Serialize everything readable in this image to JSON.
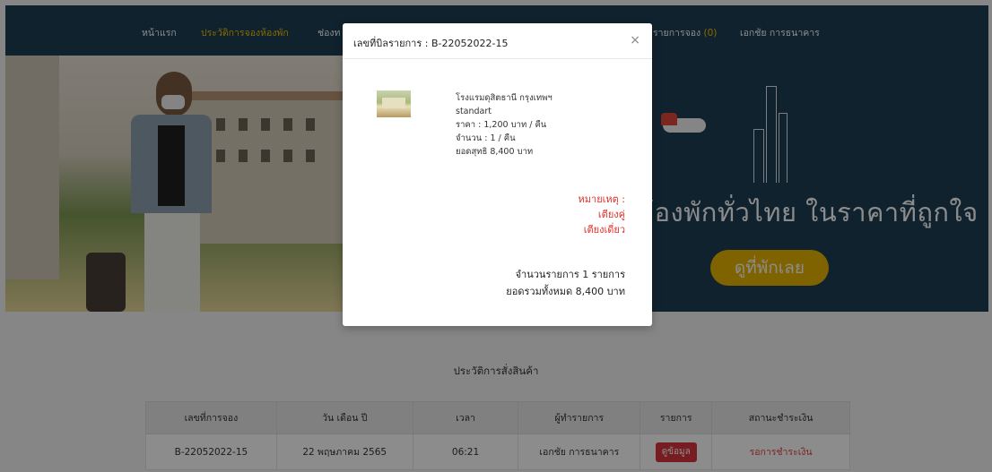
{
  "nav": {
    "home": "หน้าแรก",
    "booking_history": "ประวัติการจองห้องพัก",
    "channel": "ช่องท",
    "cart_label": "รายการจอง",
    "cart_count": "(0)",
    "user": "เอกชัย การธนาคาร"
  },
  "hero": {
    "tagline": "ห้องพักทั่วไทย ในราคาที่ถูกใจ",
    "cta": "ดูที่พักเลย"
  },
  "history": {
    "title": "ประวัติการสั่งสินค้า",
    "columns": [
      "เลขที่การจอง",
      "วัน เดือน ปี",
      "เวลา",
      "ผู้ทำรายการ",
      "รายการ",
      "สถานะชำระเงิน"
    ],
    "rows": [
      {
        "booking_no": "B-22052022-15",
        "date": "22 พฤษภาคม 2565",
        "time": "06:21",
        "by": "เอกชัย การธนาคาร",
        "action": "ดูข้อมูล",
        "status": "รอการชำระเงิน"
      }
    ]
  },
  "modal": {
    "title": "เลขที่บิลรายการ : B-22052022-15",
    "close": "×",
    "item": {
      "hotel": "โรงแรมดุสิตธานี กรุงเทพฯ",
      "room": "standart",
      "price": "ราคา : 1,200 บาท / คืน",
      "qty": "จำนวน : 1 / คืน",
      "net": "ยอดสุทธิ 8,400 บาท"
    },
    "note": {
      "label": "หมายเหตุ :",
      "line1": "เตียงคู่",
      "line2": "เตียงเดี่ยว"
    },
    "summary": {
      "count": "จำนวนรายการ 1 รายการ",
      "total": "ยอดรวมทั้งหมด 8,400 บาท"
    }
  },
  "colors": {
    "nav_bg": "#1c3f54",
    "accent": "#f6c000",
    "cta": "#e8b400",
    "danger": "#d9363e"
  }
}
